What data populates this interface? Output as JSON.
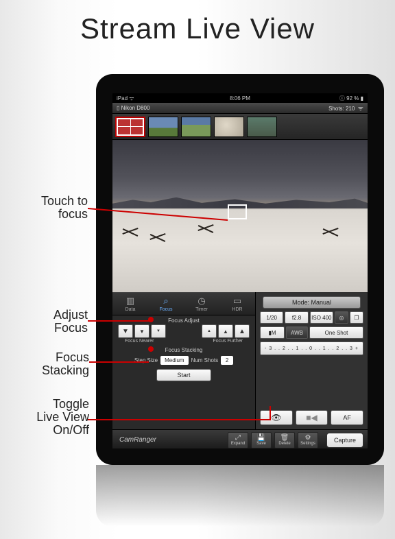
{
  "page_title": "Stream Live View",
  "ios_status": {
    "device": "iPad",
    "time": "8:06 PM",
    "battery": "92 %"
  },
  "app_header": {
    "camera": "Nikon D800",
    "shots_label": "Shots: 210"
  },
  "annotations": {
    "touch_focus": "Touch to\nfocus",
    "adjust_focus": "Adjust\nFocus",
    "focus_stacking": "Focus\nStacking",
    "toggle_live_view": "Toggle\nLive View\nOn/Off"
  },
  "tabs": {
    "data": "Data",
    "focus": "Focus",
    "timer": "Timer",
    "hdr": "HDR"
  },
  "focus_panel": {
    "adjust_label": "Focus Adjust",
    "nearer": "Focus Nearer",
    "further": "Focus Further",
    "stacking_label": "Focus Stacking",
    "step_size_label": "Step Size",
    "step_size_value": "Medium",
    "num_shots_label": "Num Shots",
    "num_shots_value": "2",
    "start": "Start"
  },
  "right_panel": {
    "mode": "Mode: Manual",
    "shutter": "1/20",
    "aperture": "f2.8",
    "iso": "ISO 400",
    "meter": "M",
    "wb": "AWB",
    "drive": "One Shot",
    "scale": "- 3 . . 2 . . 1 . . 0 . . 1 . . 2 . . 3 +",
    "af": "AF"
  },
  "footer": {
    "brand": "CamRanger",
    "expand": "Expand",
    "save": "Save",
    "delete": "Delete",
    "settings": "Settings",
    "capture": "Capture"
  }
}
